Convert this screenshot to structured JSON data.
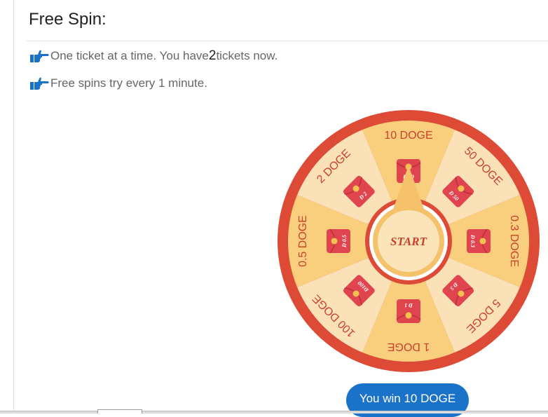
{
  "page": {
    "title": "Free Spin:"
  },
  "info": {
    "line1_prefix": "One ticket at a time. You have ",
    "ticket_count": "2",
    "line1_suffix": " tickets now.",
    "line2": "Free spins try every 1 minute.",
    "icon": "thumbs-point-right-icon"
  },
  "wheel": {
    "center_label": "START",
    "segments": [
      {
        "label": "10 DOGE",
        "envelope": "Đ 10",
        "color": "#f9cf7e"
      },
      {
        "label": "50 DOGE",
        "envelope": "Đ 50",
        "color": "#fbe1b8"
      },
      {
        "label": "0.3 DOGE",
        "envelope": "Đ 0.3",
        "color": "#f9cf7e"
      },
      {
        "label": "5 DOGE",
        "envelope": "Đ 5",
        "color": "#fbe1b8"
      },
      {
        "label": "1 DOGE",
        "envelope": "Đ 1",
        "color": "#f9cf7e"
      },
      {
        "label": "100 DOGE",
        "envelope": "Đ100",
        "color": "#fbe1b8"
      },
      {
        "label": "0.5 DOGE",
        "envelope": "Đ 0.5",
        "color": "#f9cf7e"
      },
      {
        "label": "2 DOGE",
        "envelope": "Đ 2",
        "color": "#fbe1b8"
      }
    ],
    "colors": {
      "rim": "#dd4a36",
      "pointer": "#f5c26b",
      "text": "#c8412d",
      "envelope": "#e0454f"
    }
  },
  "result": {
    "label": "You win 10 DOGE",
    "color": "#1a73c8"
  }
}
